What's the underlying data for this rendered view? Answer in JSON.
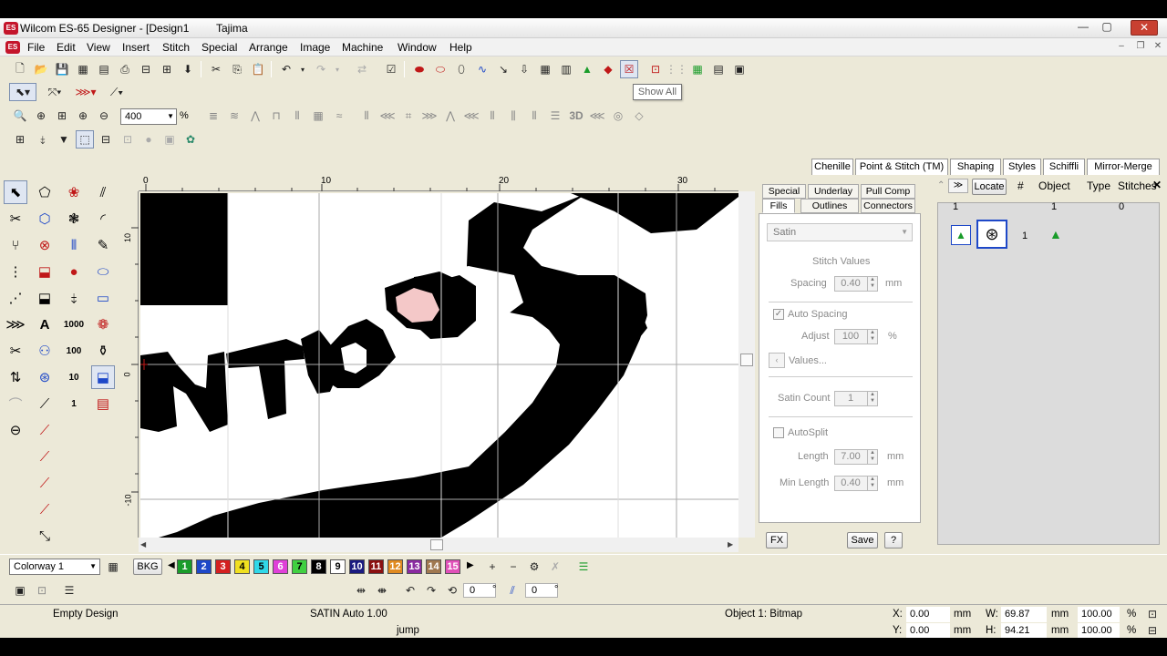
{
  "title": {
    "app_badge": "ES",
    "text": "Wilcom ES-65 Designer - [Design1",
    "machine": "Tajima",
    "min": "—",
    "max": "▢",
    "close": "✕"
  },
  "menu": {
    "items": [
      "File",
      "Edit",
      "View",
      "Insert",
      "Stitch",
      "Special",
      "Arrange",
      "Image",
      "Machine",
      "Window",
      "Help"
    ],
    "mdi_min": "–",
    "mdi_restore": "❐",
    "mdi_close": "✕"
  },
  "tooltip": "Show All",
  "zoom": {
    "value": "400",
    "unit": "%"
  },
  "toolbar_labels": {
    "three_d": "3D"
  },
  "left_tools": {
    "t1000": "1000",
    "t100": "100",
    "t10": "10",
    "t1": "1"
  },
  "ruler": {
    "h_labels": [
      "0",
      "10",
      "20",
      "30"
    ],
    "v_labels": [
      "10",
      "0",
      "-10"
    ]
  },
  "tabs": [
    "Chenille",
    "Point & Stitch (TM)",
    "Shaping",
    "Styles",
    "Schiffli",
    "Mirror-Merge"
  ],
  "props": {
    "tabs_row1": [
      "Special",
      "Underlay",
      "Pull Comp"
    ],
    "tabs_row2": [
      "Fills",
      "Outlines",
      "Connectors"
    ],
    "stitch_type": "Satin",
    "stitch_values": "Stitch Values",
    "spacing_label": "Spacing",
    "spacing_value": "0.40",
    "spacing_unit": "mm",
    "auto_spacing": "Auto Spacing",
    "adjust_label": "Adjust",
    "adjust_value": "100",
    "adjust_unit": "%",
    "values_btn": "Values...",
    "satin_count_label": "Satin Count",
    "satin_count_value": "1",
    "autosplit": "AutoSplit",
    "length_label": "Length",
    "length_value": "7.00",
    "length_unit": "mm",
    "min_length_label": "Min Length",
    "min_length_value": "0.40",
    "min_length_unit": "mm",
    "fx": "FX",
    "save": "Save",
    "help": "?"
  },
  "list": {
    "locate": "Locate",
    "headers": [
      "#",
      "Object",
      "Type",
      "Stitches"
    ],
    "close": "✕",
    "row0": [
      "1",
      "1",
      "0"
    ],
    "row1_num": "1"
  },
  "bottom": {
    "colorway": "Colorway 1",
    "bkg": "BKG",
    "swatches": [
      {
        "n": "1",
        "c": "#1a9c2a",
        "t": "#ffffff"
      },
      {
        "n": "2",
        "c": "#1e48c8",
        "t": "#ffffff"
      },
      {
        "n": "3",
        "c": "#d42020",
        "t": "#ffffff"
      },
      {
        "n": "4",
        "c": "#f0e020",
        "t": "#000000"
      },
      {
        "n": "5",
        "c": "#30d8e8",
        "t": "#000000"
      },
      {
        "n": "6",
        "c": "#e040d8",
        "t": "#ffffff"
      },
      {
        "n": "7",
        "c": "#40d040",
        "t": "#000000"
      },
      {
        "n": "8",
        "c": "#000000",
        "t": "#ffffff"
      },
      {
        "n": "9",
        "c": "#ffffff",
        "t": "#000000"
      },
      {
        "n": "10",
        "c": "#1a1a80",
        "t": "#ffffff"
      },
      {
        "n": "11",
        "c": "#8a1010",
        "t": "#ffffff"
      },
      {
        "n": "12",
        "c": "#e08a20",
        "t": "#ffffff"
      },
      {
        "n": "13",
        "c": "#8a2aa0",
        "t": "#ffffff"
      },
      {
        "n": "14",
        "c": "#a07850",
        "t": "#ffffff"
      },
      {
        "n": "15",
        "c": "#e050b8",
        "t": "#ffffff"
      }
    ],
    "rot1": "0",
    "deg1": "°",
    "rot2": "0",
    "deg2": "°"
  },
  "status": {
    "design": "Empty Design",
    "stitch": "SATIN Auto  1.00",
    "object": "Object 1: Bitmap",
    "x_label": "X:",
    "x_value": "0.00",
    "x_unit": "mm",
    "y_label": "Y:",
    "y_value": "0.00",
    "y_unit": "mm",
    "w_label": "W:",
    "w_value": "69.87",
    "w_unit": "mm",
    "w_pct": "100.00",
    "h_label": "H:",
    "h_value": "94.21",
    "h_unit": "mm",
    "h_pct": "100.00",
    "pct": "%",
    "hint": "jump"
  },
  "colors": {
    "title_red": "#c4152b",
    "accent_blue": "#1e48c8",
    "pink_fill": "#f4c8c8"
  }
}
